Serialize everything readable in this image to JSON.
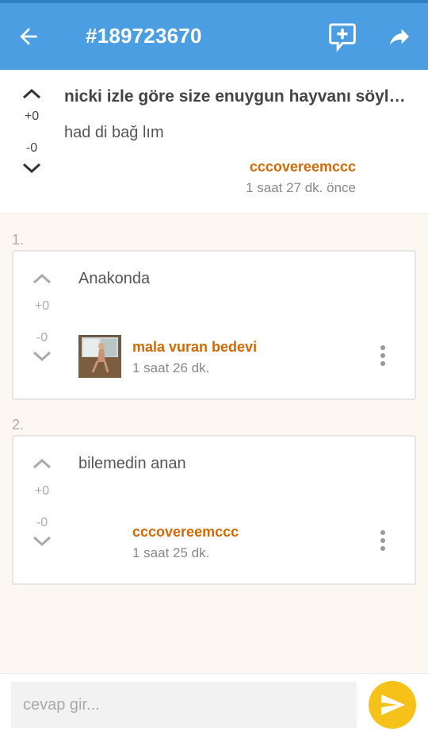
{
  "appbar": {
    "title": "#189723670",
    "back_icon": "arrow-left-icon",
    "action1_icon": "add-comment-icon",
    "action2_icon": "share-icon",
    "bg_color": "#4b9ee1"
  },
  "post": {
    "upvotes": "+0",
    "downvotes": "-0",
    "title": "nicki izle göre size enuygun hayvanı söyleyelim",
    "body": "had di bağ lım",
    "author": "cccovereemccc",
    "time": "1 saat 27 dk. önce"
  },
  "replies": [
    {
      "index": "1.",
      "upvotes": "+0",
      "downvotes": "-0",
      "text": "Anakonda",
      "author": "mala vuran bedevi",
      "time": "1 saat 26 dk.",
      "has_avatar": true
    },
    {
      "index": "2.",
      "upvotes": "+0",
      "downvotes": "-0",
      "text": "bilemedin anan",
      "author": "cccovereemccc",
      "time": "1 saat 25 dk.",
      "has_avatar": false
    }
  ],
  "composer": {
    "placeholder": "cevap gir...",
    "send_icon": "send-icon",
    "accent_color": "#f6c21a"
  },
  "colors": {
    "author": "#cf6a06",
    "background": "#fcf8f1"
  }
}
